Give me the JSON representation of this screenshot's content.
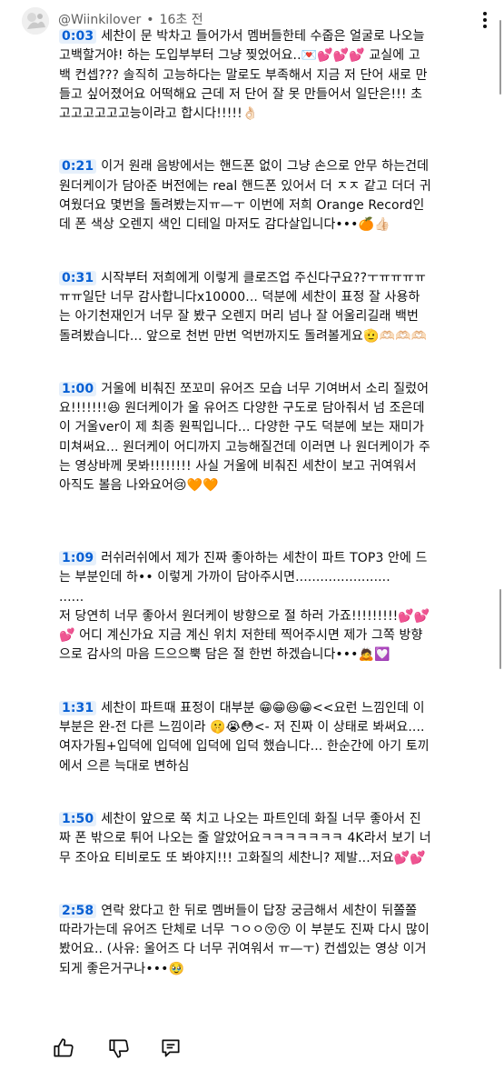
{
  "comment": {
    "author": "@Wiinkilover",
    "time": "16초 전",
    "separator": "•"
  },
  "paragraphs": [
    {
      "ts": "0:03",
      "text": "세찬이 문 박차고 들어가서 멤버들한테 수줍은 얼굴로 나오늘 고백할거야! 하는 도입부부터 그냥 찢었어요..💌💕💕💕 교실에 고백 컨셉??? 솔직히 고능하다는 말로도 부족해서 지금 저 단어 새로 만들고 싶어졌어요 어떡해요 근데 저 단어 잘 못 만들어서 일단은!!! 초고고고고고고능이라고 합시다!!!!!👌🏻"
    },
    {
      "ts": "0:21",
      "text": "이거 원래 음방에서는 핸드폰 없이 그냥 손으로 안무 하는건데 원더케이가 담아준 버전에는 real 핸드폰 있어서 더 ㅈㅈ 같고 더더 귀여웠더요 몇번을 돌려봤는지ㅠ—ㅜ 이번에 저희 Orange Record인데 폰 색상 오렌지 색인 디테일 마저도 감다살입니다•••🍊👍🏻"
    },
    {
      "ts": "0:31",
      "text": "시작부터 저희에게 이렇게 클로즈업 주신다구요??ㅜㅠㅠㅠㅠㅠㅠ일단 너무 감사합니다x10000... 덕분에 세찬이 표정 잘 사용하는 아기천재인거 너무 잘 봤구 오렌지 머리 넘나 잘 어울리길래 백번 돌려봤습니다... 앞으로 천번 만번 억번까지도 돌려볼게요🫡🫶🏻🫶🏻🫶🏻"
    },
    {
      "ts": "1:00",
      "text": "거울에 비춰진 쪼꼬미 유어즈 모습 너무 기여버서 소리 질렀어요!!!!!!!😆 원더케이가 울 유어즈 다양한 구도로 담아줘서 넘 조은데 이 거울ver이 제 최종 원픽입니다... 다양한 구도 덕분에 보는 재미가 미쳐써요... 원더케이 어디까지 고능해질건데 이러면 나 원더케이가 주는 영상바께 못봐!!!!!!!! 사실 거울에 비춰진 세찬이 보고 귀여워서 아직도 볼음 나와요어😢🧡🧡"
    },
    {
      "ts": "1:09",
      "text": "러쉬러쉬에서 제가 진짜 좋아하는 세찬이 파트 TOP3 안에 드는 부분인데 하•• 이렇게 가까이 담아주시면.......................\n......\n저 당연히 너무 좋아서 원더케이 방향으로 절 하러 가죠!!!!!!!!!💕💕💕 어디 계신가요 지금 계신 위치 저한테 찍어주시면 제가 그쪽 방향으로 감사의 마음 드으으뿍 담은 절 한번 하겠습니다•••🙇💟"
    },
    {
      "ts": "1:31",
      "text": "세찬이 파트때 표정이 대부분 😁😁😆😁<<요런 느낌인데 이 부분은 완-전 다른 느낌이라 🤫😭😳<- 저 진짜 이 상태로 봐써요....여자가됨+입덕에 입덕에 입덕에 입덕 했습니다... 한순간에 아기 토끼에서 으른 늑대로 변하심"
    },
    {
      "ts": "1:50",
      "text": "세찬이 앞으로 쭉 치고 나오는 파트인데 화질 너무 좋아서 진짜 폰 밖으로 튀어 나오는 줄 알았어요ㅋㅋㅋㅋㅋㅋㅋ 4K라서 보기 너무 조아요 티비로도 또 봐야지!!! 고화질의 세찬니? 제발...저요💕💕"
    },
    {
      "ts": "2:58",
      "text": "연락 왔다고 한 뒤로 멤버들이 답장 궁금해서 세찬이 뒤쫄쫄 따라가는데 유어즈 단체로 너무 ㄱㅇㅇ😚😚 이 부분도 진짜 다시 많이 봤어요.. (사유: 울어즈 다 너무 귀여워서 ㅠ—ㅜ) 컨셉있는 영상 이거 되게 좋은거구나•••🥹"
    }
  ],
  "icons": [
    "avatar",
    "more-vert-icon",
    "thumbs-up-icon",
    "thumbs-down-icon",
    "reply-icon"
  ],
  "colors": {
    "timestamp_text": "#065fd4",
    "timestamp_bg": "#e6f0fb",
    "meta_text": "#606060"
  }
}
